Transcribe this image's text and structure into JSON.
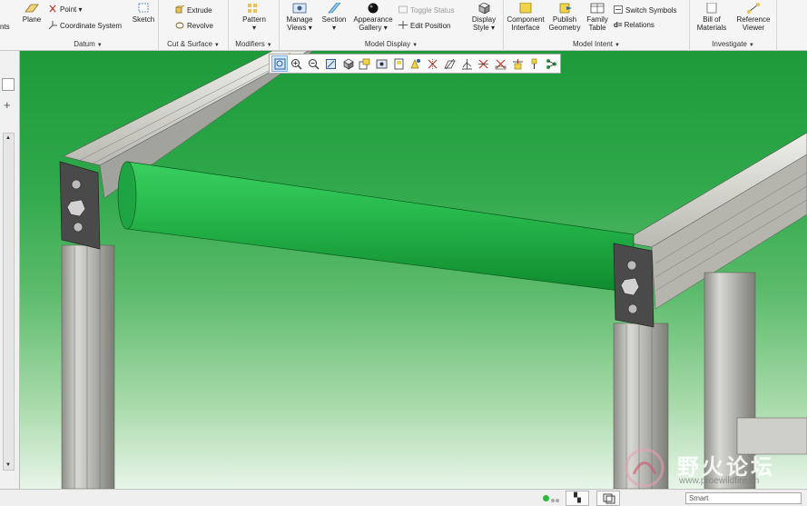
{
  "ribbon": {
    "groups": {
      "datum": {
        "label": "Datum",
        "buttons": {
          "plane": "Plane",
          "point": "Point",
          "coordinate_system": "Coordinate System",
          "sketch": "Sketch"
        }
      },
      "cut_surface": {
        "label": "Cut & Surface",
        "buttons": {
          "extrude": "Extrude",
          "revolve": "Revolve"
        }
      },
      "modifiers": {
        "label": "Modifiers",
        "buttons": {
          "pattern": "Pattern"
        }
      },
      "model_display": {
        "label": "Model Display",
        "buttons": {
          "manage_views_1": "Manage",
          "manage_views_2": "Views",
          "section": "Section",
          "appearance_1": "Appearance",
          "appearance_2": "Gallery",
          "toggle_status": "Toggle Status",
          "edit_position": "Edit Position",
          "display_style_1": "Display",
          "display_style_2": "Style"
        }
      },
      "model_intent": {
        "label": "Model Intent",
        "buttons": {
          "component_interface_1": "Component",
          "component_interface_2": "Interface",
          "publish_geometry_1": "Publish",
          "publish_geometry_2": "Geometry",
          "family_table_1": "Family",
          "family_table_2": "Table",
          "switch_symbols": "Switch Symbols",
          "relations": "Relations"
        }
      },
      "investigate": {
        "label": "Investigate",
        "buttons": {
          "bom_1": "Bill of",
          "bom_2": "Materials",
          "reference_viewer_1": "Reference",
          "reference_viewer_2": "Viewer"
        }
      }
    },
    "cut_off_left_text": "nts"
  },
  "graphics_toolbar": {
    "tools": [
      "refit-icon",
      "zoom-in-icon",
      "zoom-out-icon",
      "repaint-icon",
      "shading-icon",
      "saved-views-icon",
      "view-manager-icon",
      "perspective-icon",
      "spin-center-icon",
      "datum-planes-icon",
      "datum-axes-icon",
      "datum-points-icon",
      "coordinate-systems-icon",
      "annotations-icon",
      "csys-display-icon",
      "spin-icon",
      "appearances-icon"
    ]
  },
  "statusbar": {
    "smart_label": "Smart"
  },
  "watermark": {
    "text_cn": "野火论坛",
    "text_url": "www.proewildfire.cn"
  },
  "colors": {
    "background_top": "#1e9a3a",
    "background_bottom": "#e8f5e9",
    "roller": "#22b14c",
    "frame": "#c9c9c3"
  }
}
